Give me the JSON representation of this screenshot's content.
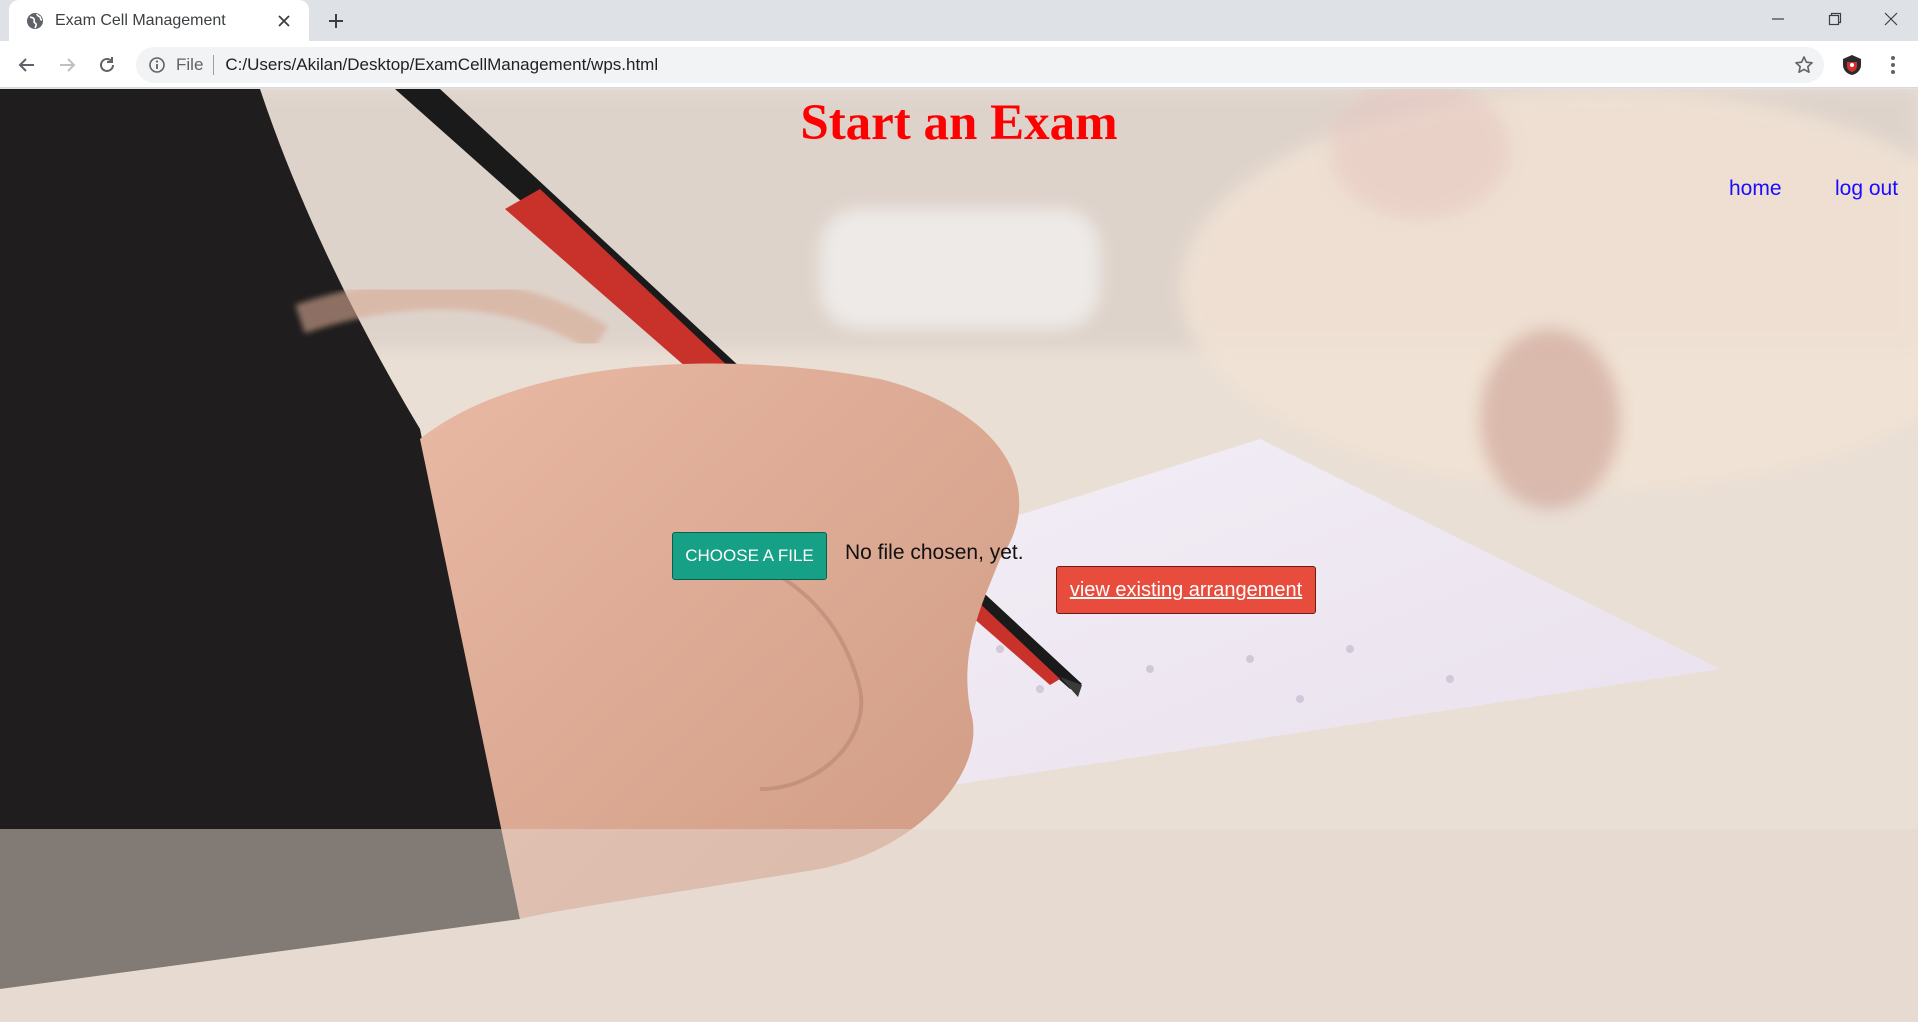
{
  "browser": {
    "tab_title": "Exam Cell Management",
    "address_scheme": "File",
    "address_url": "C:/Users/Akilan/Desktop/ExamCellManagement/wps.html"
  },
  "page": {
    "title": "Start an Exam",
    "nav": {
      "home_label": "home",
      "logout_label": "log out"
    },
    "choose_file_label": "CHOOSE A FILE",
    "file_status": "No file chosen, yet.",
    "view_arrangement_label": "view existing arrangement"
  },
  "colors": {
    "title": "#ff0000",
    "nav_link": "#1a0dff",
    "choose_button": "#16a085",
    "view_button": "#e74c3c"
  }
}
